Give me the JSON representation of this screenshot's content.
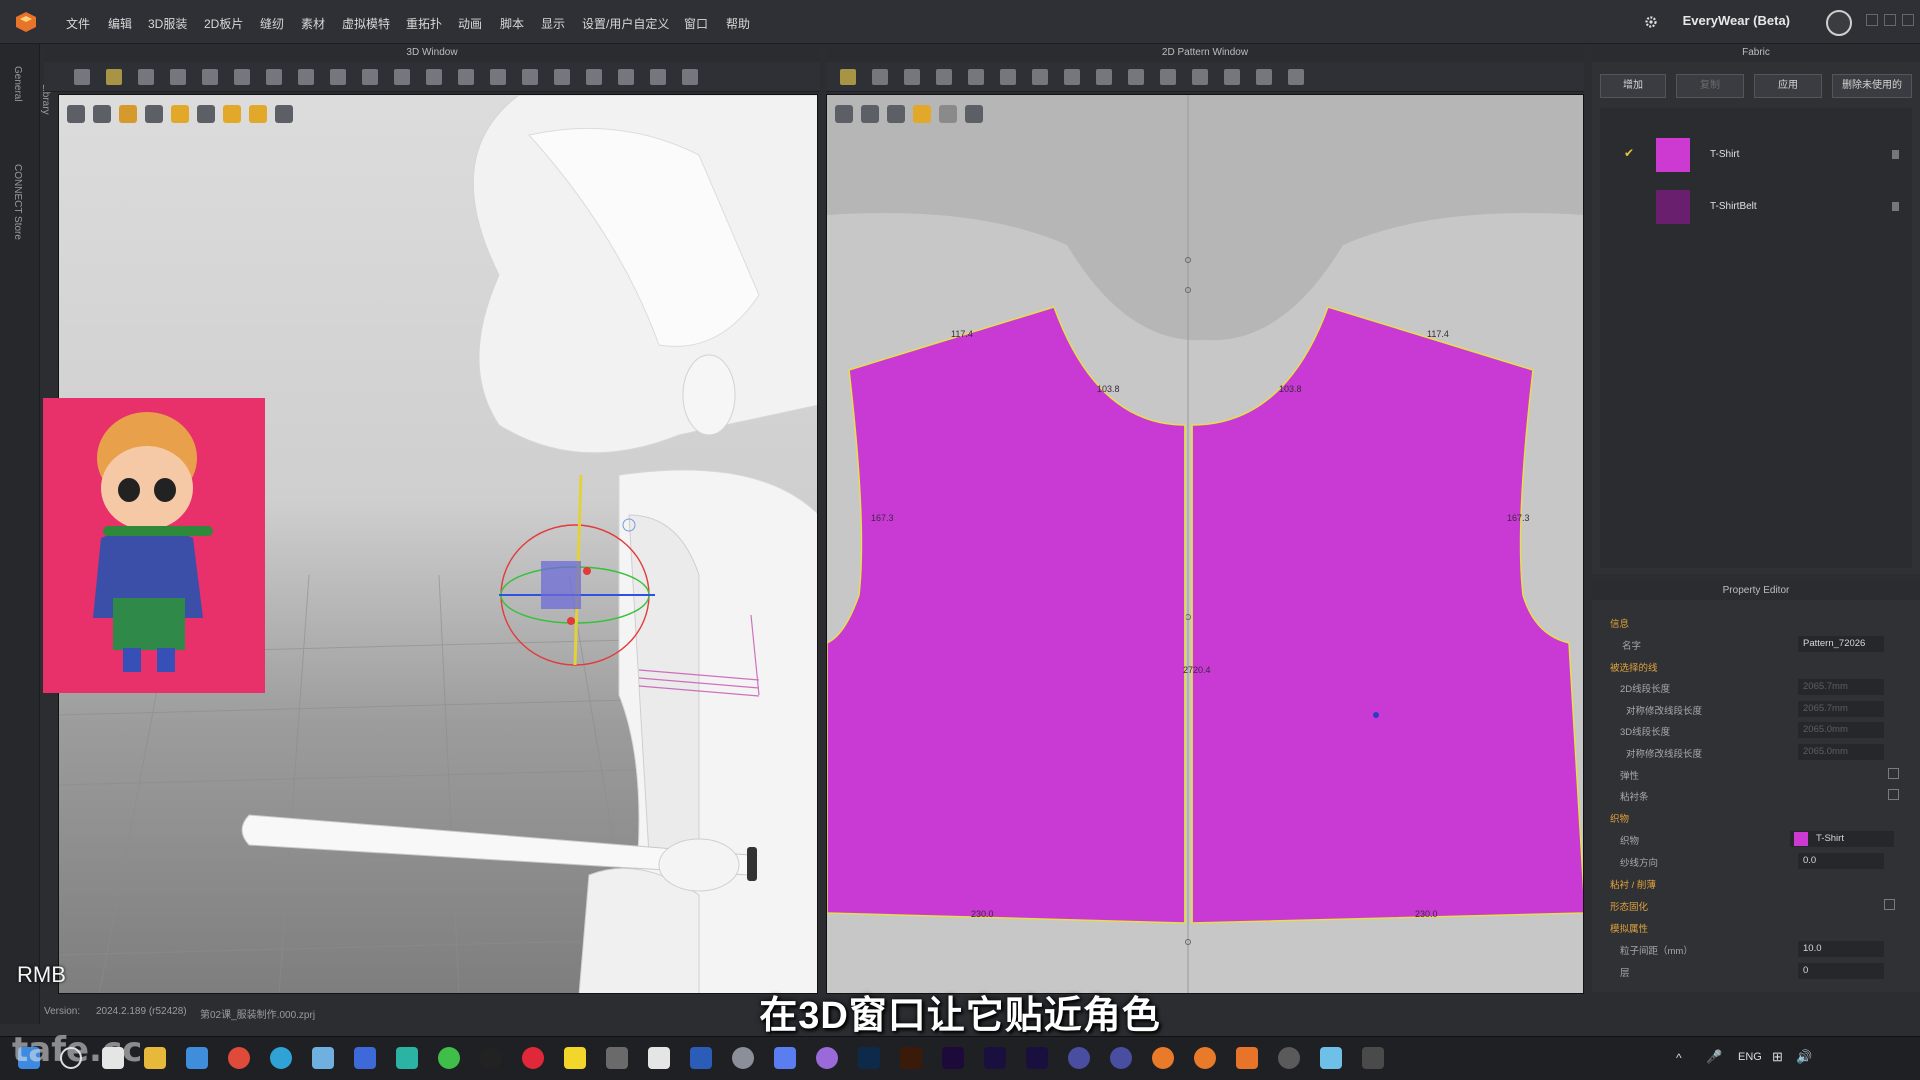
{
  "menubar": {
    "items": [
      "文件",
      "编辑",
      "3D服装",
      "2D板片",
      "缝纫",
      "素材",
      "虚拟模特",
      "重拓扑",
      "动画",
      "脚本",
      "显示",
      "设置/用户自定义",
      "窗口",
      "帮助"
    ],
    "brand": "EveryWear (Beta)"
  },
  "left_strip": {
    "tabs": [
      "General",
      "Library",
      "CONNECT Store"
    ]
  },
  "panels": {
    "window3d_title": "3D Window",
    "window2d_title": "2D Pattern Window",
    "fabric_title": "Fabric",
    "property_title": "Property Editor"
  },
  "fabric": {
    "buttons": [
      "增加",
      "复制",
      "应用",
      "删除未使用的"
    ],
    "items": [
      {
        "name": "T-Shirt",
        "color": "#cc3ad1",
        "selected": true
      },
      {
        "name": "T-ShirtBelt",
        "color": "#6a1f6e",
        "selected": false
      }
    ]
  },
  "property_editor": {
    "rows": [
      {
        "label": "信息",
        "type": "section"
      },
      {
        "label": "名字",
        "value": "Pattern_72026"
      },
      {
        "label": "被选择的线",
        "type": "section"
      },
      {
        "label": "2D线段长度",
        "value": "2065.7mm"
      },
      {
        "label": "对称修改线段长度",
        "value": "2065.7mm"
      },
      {
        "label": "3D线段长度",
        "value": "2065.0mm"
      },
      {
        "label": "对称修改线段长度",
        "value": "2065.0mm"
      },
      {
        "label": "弹性",
        "type": "check"
      },
      {
        "label": "粘衬条",
        "type": "check"
      },
      {
        "label": "织物",
        "type": "section"
      },
      {
        "label": "织物",
        "value": "T-Shirt",
        "type": "fabric"
      },
      {
        "label": "纱线方向",
        "value": "0.0"
      },
      {
        "label": "粘衬 / 削薄",
        "type": "section"
      },
      {
        "label": "形态固化",
        "type": "check-section"
      },
      {
        "label": "模拟属性",
        "type": "section"
      },
      {
        "label": "粒子间距（mm）",
        "value": "10.0"
      },
      {
        "label": "层",
        "value": "0"
      }
    ]
  },
  "pattern_labels": {
    "shoulder_left": "117.4",
    "shoulder_right": "117.4",
    "neck_left": "103.8",
    "neck_right": "103.8",
    "side_left": "167.3",
    "side_right": "167.3",
    "center": "2720.4",
    "hem_left": "230.0",
    "hem_right": "230.0"
  },
  "status": {
    "version_label": "Version:",
    "version": "2024.2.189 (r52428)",
    "file": "第02课_服装制作.000.zprj"
  },
  "subtitle": "在3D窗口让它贴近角色",
  "rmb": "RMB",
  "watermark": "tafe.cc",
  "taskbar": {
    "lang": "ENG"
  }
}
